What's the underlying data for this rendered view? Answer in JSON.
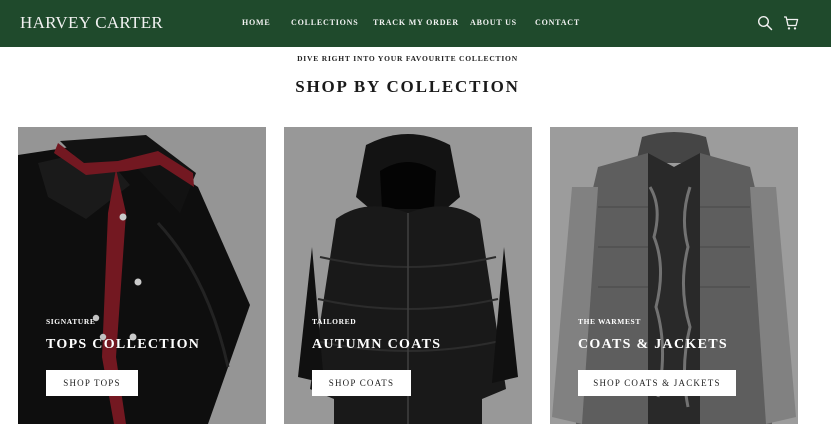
{
  "header": {
    "brand": "HARVEY CARTER",
    "nav": [
      {
        "label": "HOME"
      },
      {
        "label": "COLLECTIONS"
      },
      {
        "label": "TRACK MY ORDER"
      },
      {
        "label": "ABOUT US"
      },
      {
        "label": "CONTACT"
      }
    ],
    "icons": [
      "search-icon",
      "cart-icon"
    ],
    "background_color": "#1f4a2c"
  },
  "section": {
    "eyebrow": "DIVE RIGHT INTO YOUR FAVOURITE COLLECTION",
    "title": "SHOP BY COLLECTION"
  },
  "collections": [
    {
      "kicker": "SIGNATURE",
      "title": "TOPS COLLECTION",
      "button": "SHOP TOPS",
      "image": "black-shirt"
    },
    {
      "kicker": "TAILORED",
      "title": "AUTUMN COATS",
      "button": "SHOP COATS",
      "image": "black-puffer-jacket"
    },
    {
      "kicker": "THE WARMEST",
      "title": "COATS & JACKETS",
      "button": "SHOP COATS & JACKETS",
      "image": "grey-knit-puffer-jacket"
    }
  ]
}
